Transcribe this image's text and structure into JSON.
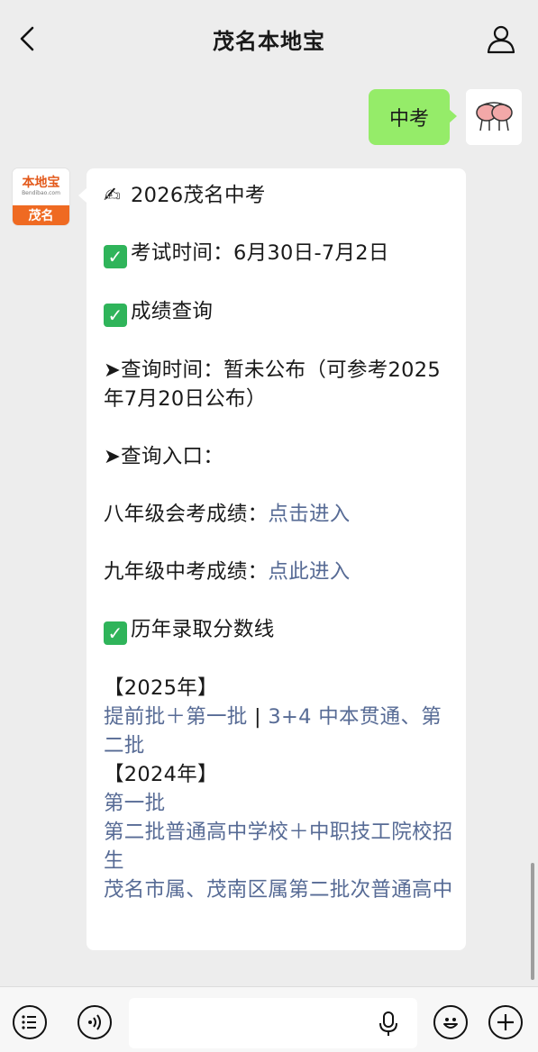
{
  "header": {
    "title": "茂名本地宝"
  },
  "outgoing": {
    "text": "中考"
  },
  "bot_avatar": {
    "brand": "本地宝",
    "url": "Bendibao.com",
    "city": "茂名"
  },
  "message": {
    "title_emoji": "✍",
    "title": "2026茂名中考",
    "exam_time": "考试时间：6月30日-7月2日",
    "score_query": "成绩查询",
    "query_time": "➤查询时间：暂未公布（可参考2025年7月20日公布）",
    "query_entry": "➤查询入口：",
    "grade8_label": "八年级会考成绩：",
    "grade8_link": "点击进入",
    "grade9_label": "九年级中考成绩：",
    "grade9_link": "点此进入",
    "history": "历年录取分数线",
    "y2025_label": "【2025年】",
    "y2025_link1": "提前批＋第一批",
    "separator": " | ",
    "y2025_link2": "3+4 中本贯通、第二批",
    "y2024_label": "【2024年】",
    "y2024_link1": "第一批",
    "y2024_link2": "第二批普通高中学校＋中职技工院校招生",
    "y2024_link3": "茂名市属、茂南区属第二批次普通高中",
    "check_mark": "✓"
  },
  "colors": {
    "bubble_green": "#95ec69",
    "link": "#576b95",
    "check": "#2fb45a",
    "brand_orange": "#ef6a22"
  }
}
